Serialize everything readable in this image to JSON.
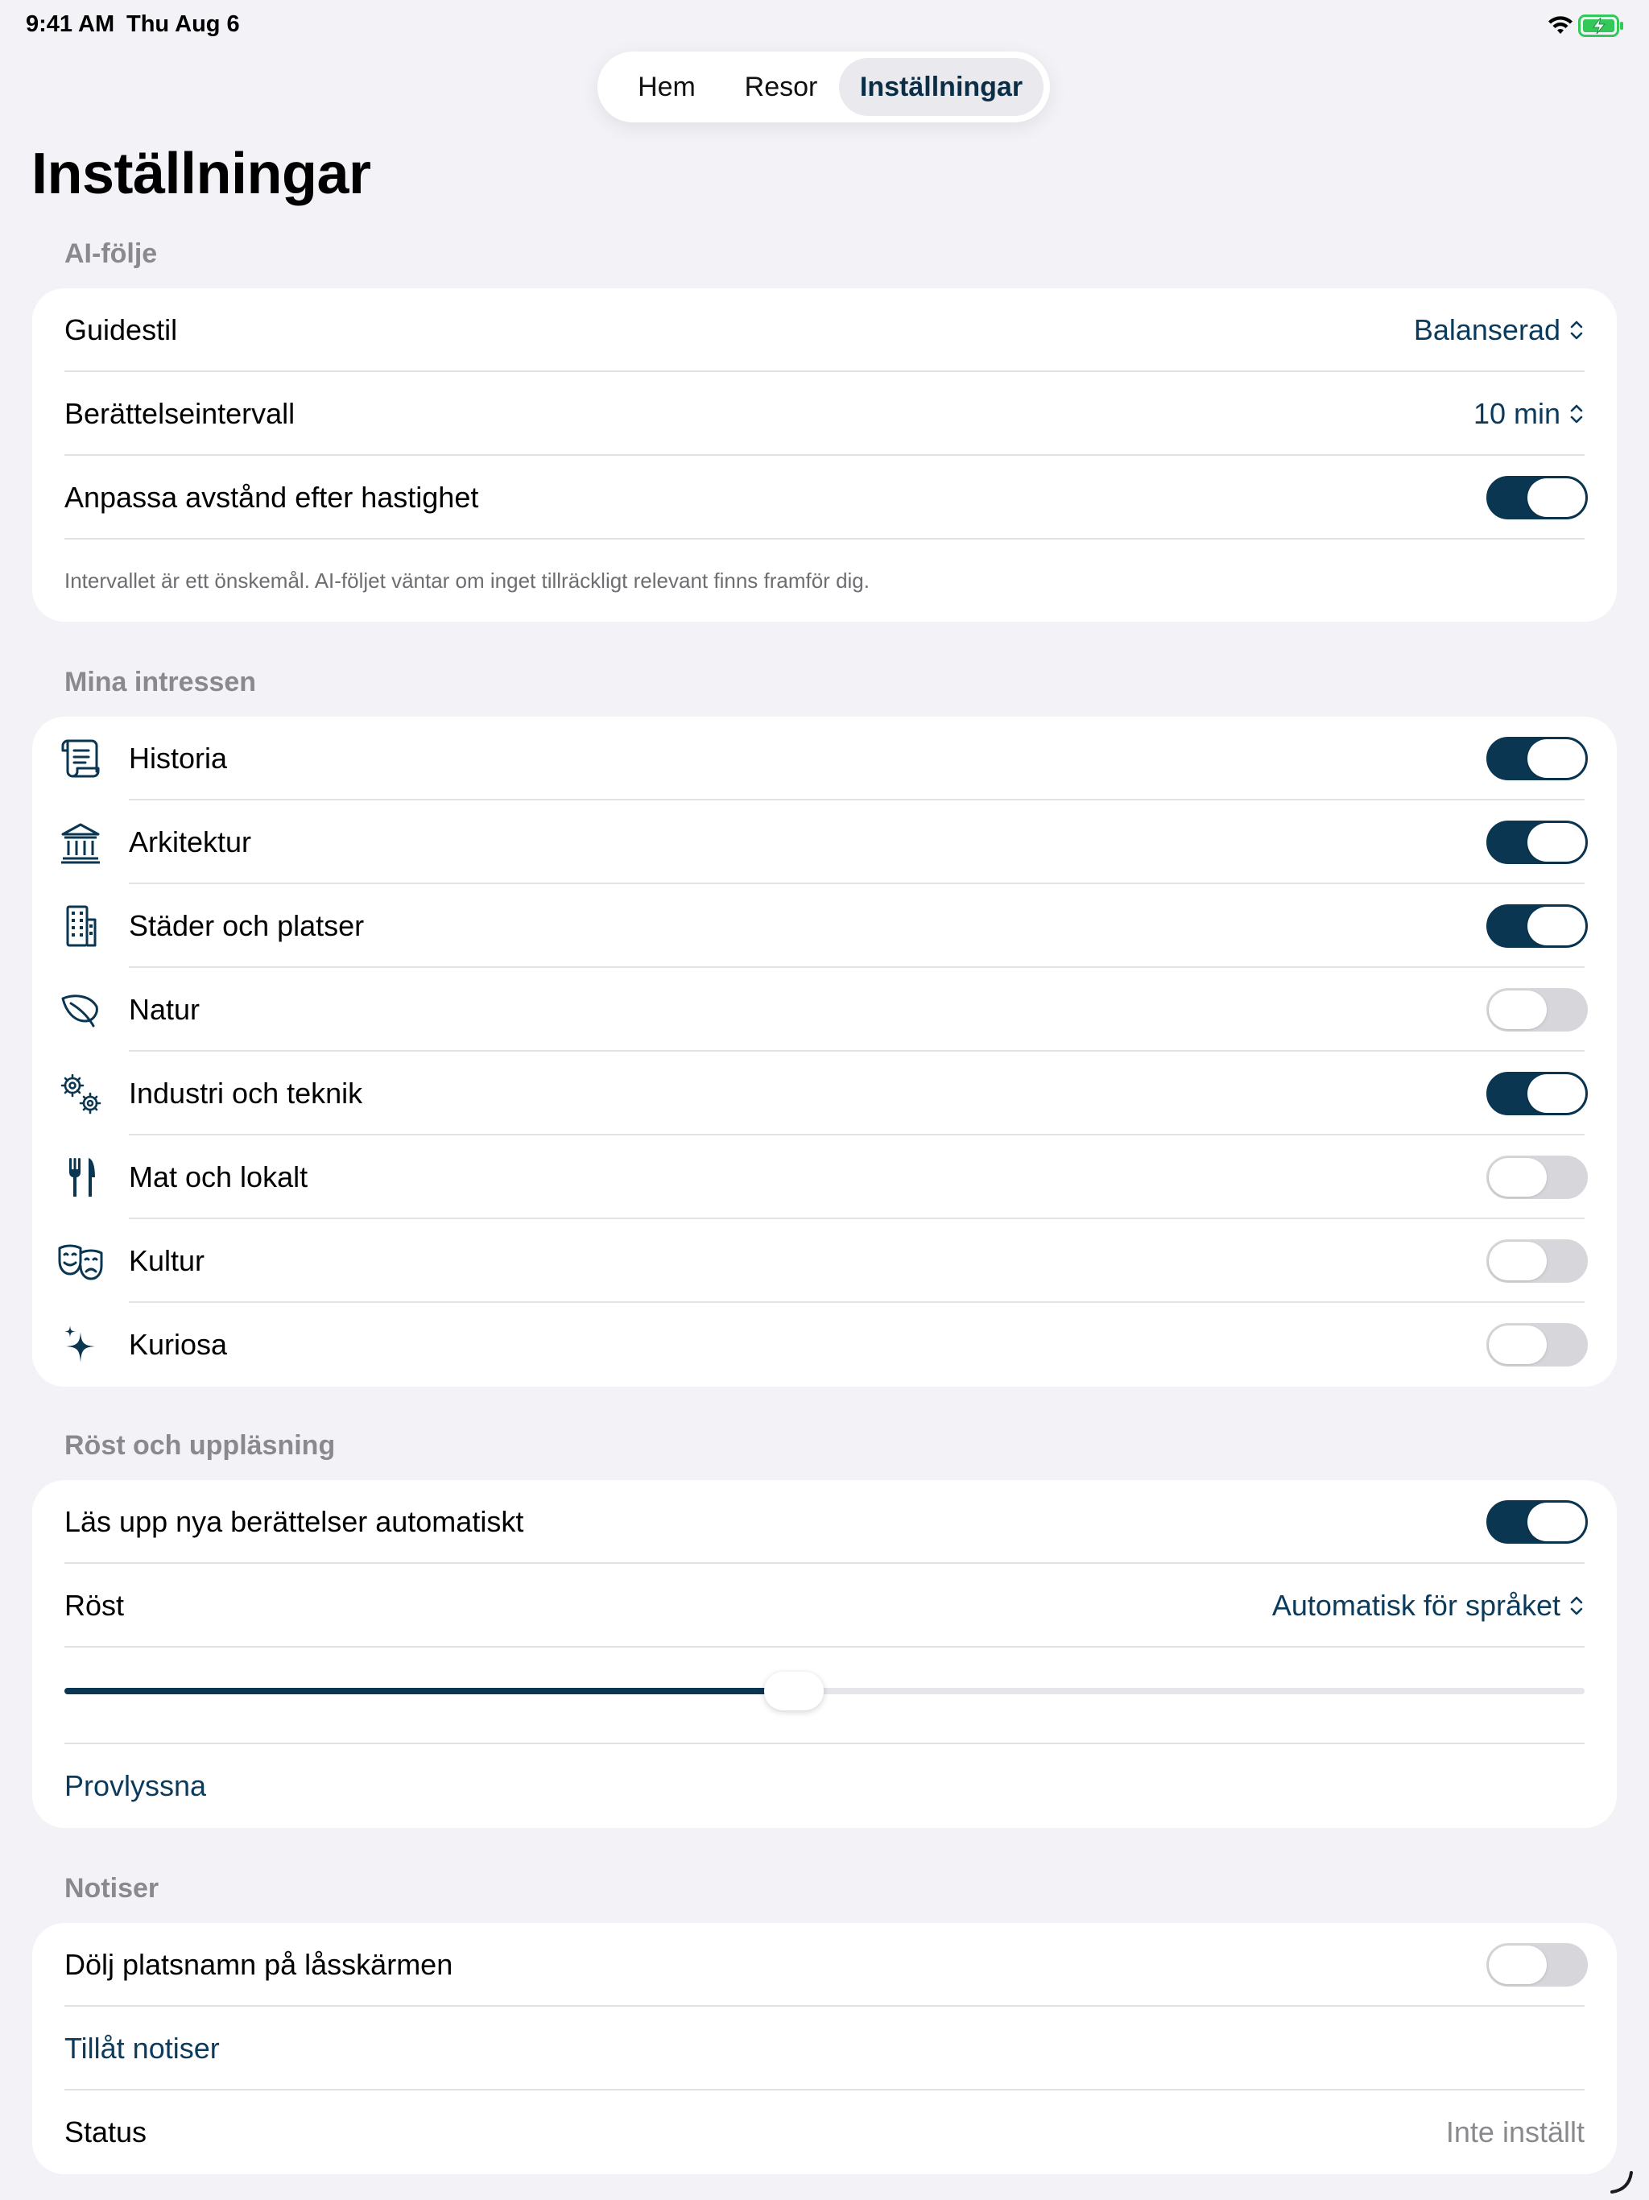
{
  "status_bar": {
    "time": "9:41 AM",
    "date": "Thu Aug 6",
    "wifi_icon": "wifi-icon",
    "battery_icon": "battery-charging-icon",
    "battery_color": "#34C759"
  },
  "tabs": [
    {
      "label": "Hem",
      "selected": false
    },
    {
      "label": "Resor",
      "selected": false
    },
    {
      "label": "Inställningar",
      "selected": true
    }
  ],
  "page_title": "Inställningar",
  "colors": {
    "accent": "#0B3651",
    "link": "#0B3B5C",
    "toggle_off": "#D7D7DB",
    "background": "#F2F2F7"
  },
  "ai_companion": {
    "header": "AI-följe",
    "guide_style": {
      "label": "Guidestil",
      "value": "Balanserad"
    },
    "story_interval": {
      "label": "Berättelseintervall",
      "value": "10 min"
    },
    "adapt_distance": {
      "label": "Anpassa avstånd efter hastighet",
      "on": true
    },
    "footnote": "Intervallet är ett önskemål. AI-följet väntar om inget tillräckligt relevant finns framför dig."
  },
  "interests": {
    "header": "Mina intressen",
    "items": [
      {
        "label": "Historia",
        "icon": "scroll-icon",
        "on": true
      },
      {
        "label": "Arkitektur",
        "icon": "building-columns-icon",
        "on": true
      },
      {
        "label": "Städer och platser",
        "icon": "city-building-icon",
        "on": true
      },
      {
        "label": "Natur",
        "icon": "leaf-icon",
        "on": false
      },
      {
        "label": "Industri och teknik",
        "icon": "gears-icon",
        "on": true
      },
      {
        "label": "Mat och lokalt",
        "icon": "fork-knife-icon",
        "on": false
      },
      {
        "label": "Kultur",
        "icon": "theater-masks-icon",
        "on": false
      },
      {
        "label": "Kuriosa",
        "icon": "sparkles-icon",
        "on": false
      }
    ]
  },
  "voice": {
    "header": "Röst och uppläsning",
    "auto_read": {
      "label": "Läs upp nya berättelser automatiskt",
      "on": true
    },
    "voice": {
      "label": "Röst",
      "value": "Automatisk för språket"
    },
    "speed_fraction": 0.48,
    "preview": "Provlyssna"
  },
  "notifications": {
    "header": "Notiser",
    "hide_place_names": {
      "label": "Dölj platsnamn på låsskärmen",
      "on": false
    },
    "allow": "Tillåt notiser",
    "status": {
      "label": "Status",
      "value": "Inte inställt"
    }
  }
}
